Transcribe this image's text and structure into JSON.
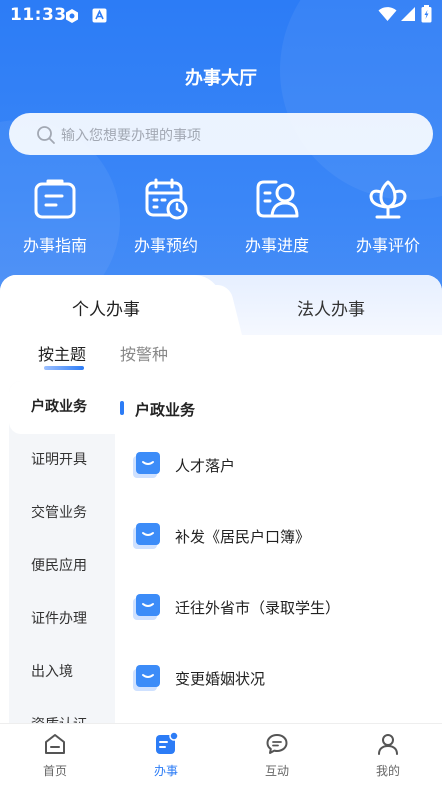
{
  "status_bar": {
    "time": "11:33",
    "icons": [
      "app-notification-icon",
      "keyboard-a-icon",
      "wifi-icon",
      "signal-icon",
      "battery-icon"
    ]
  },
  "header": {
    "title": "办事大厅"
  },
  "search": {
    "placeholder": "输入您想要办理的事项"
  },
  "quick_actions": [
    {
      "label": "办事指南",
      "icon": "guide-icon"
    },
    {
      "label": "办事预约",
      "icon": "calendar-clock-icon"
    },
    {
      "label": "办事进度",
      "icon": "progress-person-icon"
    },
    {
      "label": "办事评价",
      "icon": "flower-rating-icon"
    }
  ],
  "tabs": [
    {
      "label": "个人办事",
      "active": true
    },
    {
      "label": "法人办事",
      "active": false
    }
  ],
  "sub_tabs": [
    {
      "label": "按主题",
      "active": true
    },
    {
      "label": "按警种",
      "active": false
    }
  ],
  "categories": [
    {
      "label": "户政业务",
      "active": true
    },
    {
      "label": "证明开具"
    },
    {
      "label": "交管业务"
    },
    {
      "label": "便民应用"
    },
    {
      "label": "证件办理"
    },
    {
      "label": "出入境"
    },
    {
      "label": "资质认证"
    }
  ],
  "section": {
    "title": "户政业务"
  },
  "items": [
    {
      "label": "人才落户"
    },
    {
      "label": "补发《居民户口簿》"
    },
    {
      "label": "迁往外省市（录取学生）"
    },
    {
      "label": "变更婚姻状况"
    }
  ],
  "bottom_nav": [
    {
      "label": "首页",
      "icon": "home-icon",
      "active": false
    },
    {
      "label": "办事",
      "icon": "service-icon",
      "active": true
    },
    {
      "label": "互动",
      "icon": "chat-icon",
      "active": false
    },
    {
      "label": "我的",
      "icon": "profile-icon",
      "active": false
    }
  ],
  "colors": {
    "primary": "#2c7cf6",
    "background": "#f4f6f9",
    "text": "#222222"
  }
}
